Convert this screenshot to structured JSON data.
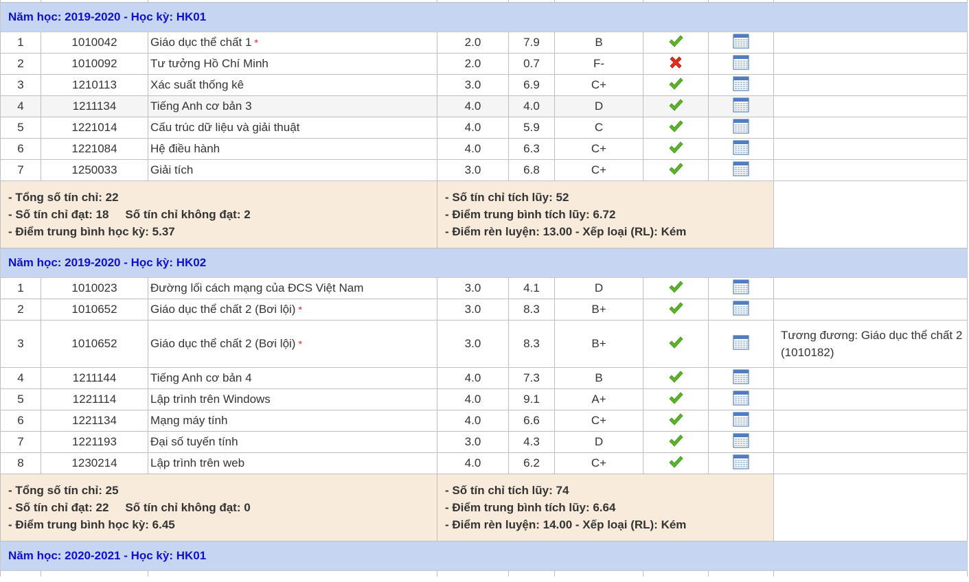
{
  "semesters": [
    {
      "header_text": "Năm học: 2019-2020 - Học kỳ: HK01",
      "courses": [
        {
          "stt": "1",
          "code": "1010042",
          "name": "Giáo dục thể chất 1",
          "star": "*",
          "credits": "2.0",
          "score": "7.9",
          "grade": "B",
          "status": "pass",
          "note": ""
        },
        {
          "stt": "2",
          "code": "1010092",
          "name": "Tư tưởng Hồ Chí Minh",
          "star": "",
          "credits": "2.0",
          "score": "0.7",
          "grade": "F-",
          "status": "fail",
          "note": ""
        },
        {
          "stt": "3",
          "code": "1210113",
          "name": "Xác suất thống kê",
          "star": "",
          "credits": "3.0",
          "score": "6.9",
          "grade": "C+",
          "status": "pass",
          "note": ""
        },
        {
          "stt": "4",
          "code": "1211134",
          "name": "Tiếng Anh cơ bản 3",
          "star": "",
          "credits": "4.0",
          "score": "4.0",
          "grade": "D",
          "status": "pass",
          "note": ""
        },
        {
          "stt": "5",
          "code": "1221014",
          "name": "Cấu trúc dữ liệu và giải thuật",
          "star": "",
          "credits": "4.0",
          "score": "5.9",
          "grade": "C",
          "status": "pass",
          "note": ""
        },
        {
          "stt": "6",
          "code": "1221084",
          "name": "Hệ điều hành",
          "star": "",
          "credits": "4.0",
          "score": "6.3",
          "grade": "C+",
          "status": "pass",
          "note": ""
        },
        {
          "stt": "7",
          "code": "1250033",
          "name": "Giải tích",
          "star": "",
          "credits": "3.0",
          "score": "6.8",
          "grade": "C+",
          "status": "pass",
          "note": ""
        }
      ],
      "summary": {
        "total_credits": "- Tổng số tín chỉ: 22",
        "passed_credits": "- Số tín chỉ đạt: 18",
        "failed_credits": "Số tín chỉ không đạt: 2",
        "semester_gpa": "- Điểm trung bình học kỳ: 5.37",
        "accumulated_credits": "- Số tín chỉ tích lũy: 52",
        "accumulated_gpa": "- Điểm trung bình tích lũy: 6.72",
        "conduct": "- Điểm rèn luyện: 13.00 - Xếp loại (RL): Kém"
      }
    },
    {
      "header_text": "Năm học: 2019-2020 - Học kỳ: HK02",
      "courses": [
        {
          "stt": "1",
          "code": "1010023",
          "name": "Đường lối cách mạng của ĐCS Việt Nam",
          "star": "",
          "credits": "3.0",
          "score": "4.1",
          "grade": "D",
          "status": "pass",
          "note": ""
        },
        {
          "stt": "2",
          "code": "1010652",
          "name": "Giáo dục thể chất 2 (Bơi lội)",
          "star": "*",
          "credits": "3.0",
          "score": "8.3",
          "grade": "B+",
          "status": "pass",
          "note": ""
        },
        {
          "stt": "3",
          "code": "1010652",
          "name": "Giáo dục thể chất 2 (Bơi lội)",
          "star": "*",
          "credits": "3.0",
          "score": "8.3",
          "grade": "B+",
          "status": "pass",
          "note": "Tương đương: Giáo dục thể chất 2 (1010182)"
        },
        {
          "stt": "4",
          "code": "1211144",
          "name": "Tiếng Anh cơ bản 4",
          "star": "",
          "credits": "4.0",
          "score": "7.3",
          "grade": "B",
          "status": "pass",
          "note": ""
        },
        {
          "stt": "5",
          "code": "1221114",
          "name": "Lập trình trên Windows",
          "star": "",
          "credits": "4.0",
          "score": "9.1",
          "grade": "A+",
          "status": "pass",
          "note": ""
        },
        {
          "stt": "6",
          "code": "1221134",
          "name": "Mạng máy tính",
          "star": "",
          "credits": "4.0",
          "score": "6.6",
          "grade": "C+",
          "status": "pass",
          "note": ""
        },
        {
          "stt": "7",
          "code": "1221193",
          "name": "Đại số tuyến tính",
          "star": "",
          "credits": "3.0",
          "score": "4.3",
          "grade": "D",
          "status": "pass",
          "note": ""
        },
        {
          "stt": "8",
          "code": "1230214",
          "name": "Lập trình trên web",
          "star": "",
          "credits": "4.0",
          "score": "6.2",
          "grade": "C+",
          "status": "pass",
          "note": ""
        }
      ],
      "summary": {
        "total_credits": "- Tổng số tín chỉ: 25",
        "passed_credits": "- Số tín chỉ đạt: 22",
        "failed_credits": "Số tín chỉ không đạt: 0",
        "semester_gpa": "- Điểm trung bình học kỳ: 6.45",
        "accumulated_credits": "- Số tín chỉ tích lũy: 74",
        "accumulated_gpa": "- Điểm trung bình tích lũy: 6.64",
        "conduct": "- Điểm rèn luyện: 14.00 - Xếp loại (RL): Kém"
      }
    },
    {
      "header_text": "Năm học: 2020-2021 - Học kỳ: HK01",
      "courses": [],
      "summary": null
    }
  ],
  "icons": {
    "pass": "check-icon",
    "fail": "cross-icon",
    "detail": "calendar-icon"
  },
  "colors": {
    "semester_header_bg": "#c5d5f2",
    "semester_header_text": "#1010c8",
    "summary_bg": "#f8ebdb",
    "pass_green": "#5ab52a",
    "fail_red": "#e0301e"
  }
}
